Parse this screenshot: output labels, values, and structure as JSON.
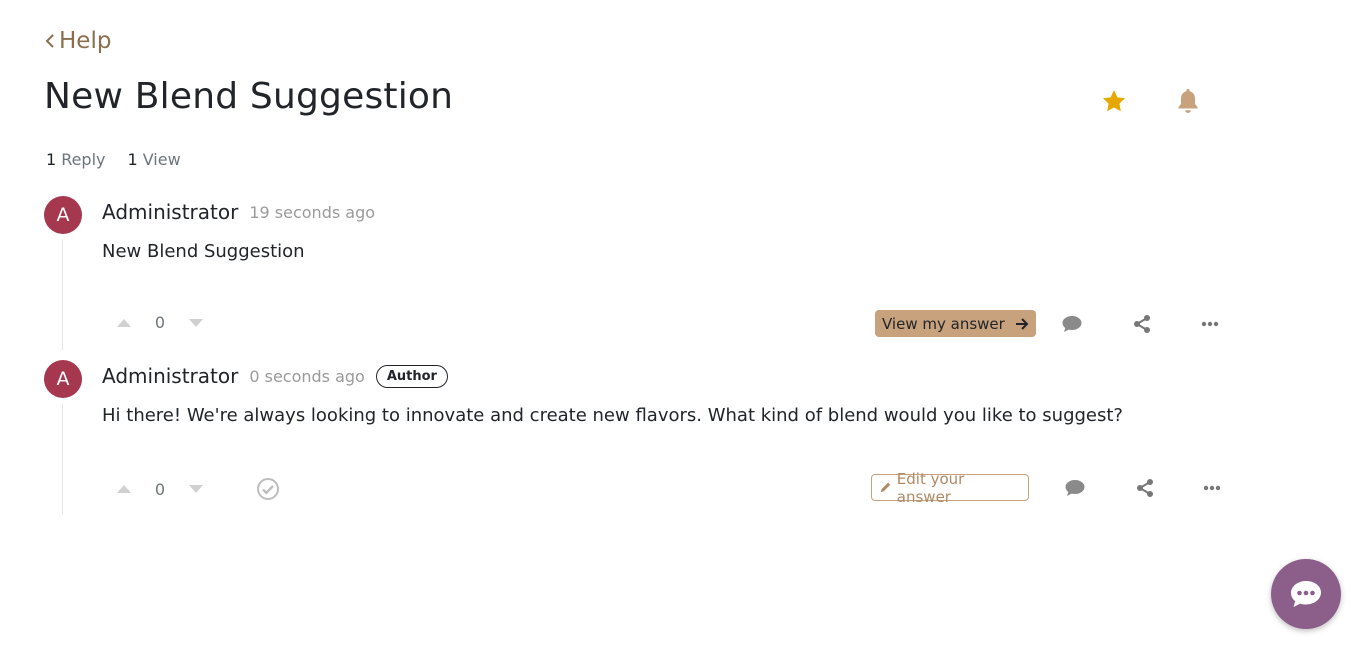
{
  "breadcrumb": {
    "label": "Help"
  },
  "title": "New Blend Suggestion",
  "title_actions": {
    "favorite_icon": "star-icon",
    "subscribe_icon": "bell-icon"
  },
  "stats": {
    "replies_count": "1",
    "replies_label": "Reply",
    "views_count": "1",
    "views_label": "View"
  },
  "posts": [
    {
      "avatar_letter": "A",
      "author": "Administrator",
      "time": "19 seconds ago",
      "badge": "",
      "body": "New Blend Suggestion",
      "votes": "0",
      "primary_action": "View my answer"
    },
    {
      "avatar_letter": "A",
      "author": "Administrator",
      "time": "0 seconds ago",
      "badge": "Author",
      "body": "Hi there! We're always looking to innovate and create new flavors. What kind of blend would you like to suggest?",
      "votes": "0",
      "primary_action": "Edit your answer"
    }
  ],
  "colors": {
    "accent": "#c8a27c",
    "avatar": "#a5384f",
    "star": "#e6a800",
    "fab": "#8c5f8a"
  }
}
